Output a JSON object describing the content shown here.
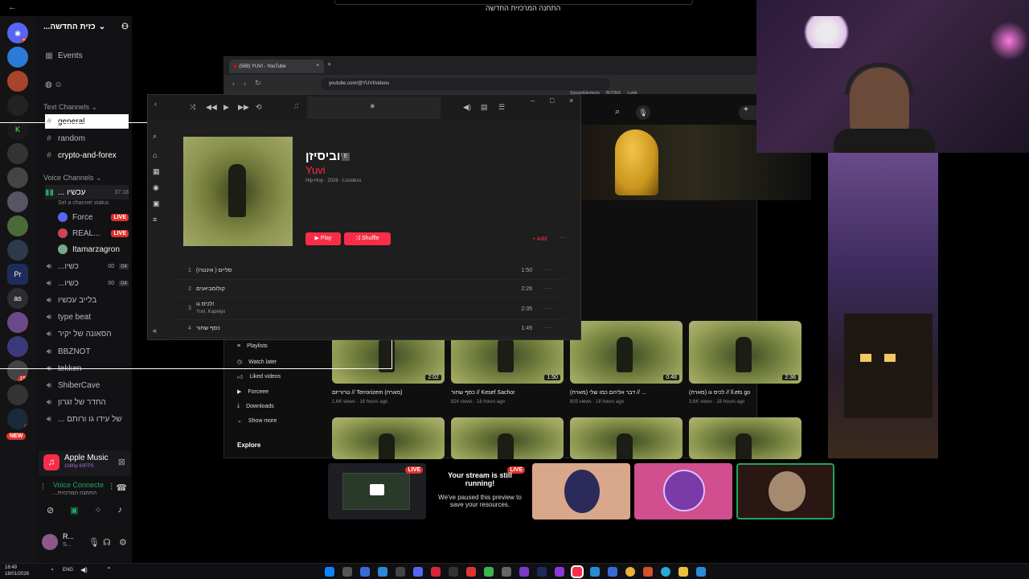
{
  "top_bar": {
    "server_title": "התחנה המרכזית החדשה"
  },
  "server_rail": {
    "badges": [
      "52",
      "6",
      "2",
      "9",
      "152",
      "8"
    ],
    "labels": [
      "Pr",
      "as"
    ],
    "new_label": "NEW"
  },
  "sidebar": {
    "server_name": "...כזית החדשה",
    "events": "Events",
    "text_channels_label": "Text Channels",
    "text_channels": [
      "general",
      "random",
      "crypto-and-forex"
    ],
    "voice_channels_label": "Voice Channels",
    "voice_active": {
      "name": "... עכשיו",
      "time": "37:18",
      "status": "Set a channel status"
    },
    "voice_users": [
      {
        "name": "Force",
        "live": "LIVE"
      },
      {
        "name": "REAL...",
        "live": "LIVE"
      },
      {
        "name": "Itamarzagron",
        "live": ""
      }
    ],
    "voice_channels": [
      {
        "name": "...כשיו",
        "a": "00",
        "b": "04"
      },
      {
        "name": "...כשיו",
        "a": "00",
        "b": "04"
      },
      {
        "name": "בלייב עכשיו",
        "a": "",
        "b": ""
      },
      {
        "name": "type beat",
        "a": "",
        "b": ""
      },
      {
        "name": "הסאונה של יקיר",
        "a": "",
        "b": ""
      },
      {
        "name": "BBZNOT",
        "a": "",
        "b": ""
      },
      {
        "name": "tekken",
        "a": "",
        "b": ""
      },
      {
        "name": "ShiberCave",
        "a": "",
        "b": ""
      },
      {
        "name": "החדר של זגרון",
        "a": "",
        "b": ""
      },
      {
        "name": "... של עידו גו ורותם",
        "a": "",
        "b": ""
      }
    ],
    "activity": {
      "title": "Apple Music",
      "sub": "1080p 60FPS"
    },
    "voice_connected": {
      "title": "Voice Connecte",
      "sub": "...התחנה המרכזית"
    },
    "user": {
      "name": "R...",
      "status": "S..."
    }
  },
  "youtube": {
    "tab_title": "(569) YUVI - YouTube",
    "url": "youtube.com/@YUVI/videos",
    "bookmarks": [
      "Sites",
      "YouTube Music",
      "Home",
      "Twitch",
      "Kick",
      "BOTBIX",
      "Lurkit",
      "StreamElements"
    ],
    "nav": [
      "Playlists",
      "Watch later",
      "Liked videos",
      "Forceee",
      "Downloads",
      "Show more"
    ],
    "explore": "Explore",
    "videos_row1": [
      {
        "title": "טרוריזם // Terrorizem (מארח)",
        "meta": "1.6K views · 18 hours ago",
        "dur": "2:02"
      },
      {
        "title": "כסף שחור // Kesef Sachor",
        "meta": "824 views · 18 hours ago",
        "dur": "1:50"
      },
      {
        "title": "(מארח) דבר אליהם כמו שלי // ...",
        "meta": "803 views · 18 hours ago",
        "dur": "0:48"
      },
      {
        "title": "(מארח) לכיס גו // ll.ets go",
        "meta": "3.6K views · 18 hours ago",
        "dur": "2:36"
      }
    ]
  },
  "apple_music": {
    "album": "יוביסיזן",
    "artist": "Yuvi",
    "meta": "Hip-Hop · 2026 · Lossless",
    "play": "Play",
    "shuffle": "Shuffle",
    "add": "+ Add",
    "tracks": [
      {
        "n": "1",
        "title": "סליים ( אינטרו)",
        "sub": "",
        "dur": "1:50"
      },
      {
        "n": "2",
        "title": "קולומביאנים",
        "sub": "",
        "dur": "2:26"
      },
      {
        "n": "3",
        "title": "לכיס גו!",
        "sub": "Yuvi, Kapelyo",
        "dur": "2:35"
      },
      {
        "n": "4",
        "title": "כסף שחור",
        "sub": "",
        "dur": "1:49"
      }
    ]
  },
  "stream": {
    "live": "LIVE",
    "paused_title": "Your stream is still running!",
    "paused_sub": "We've paused this preview to save your resources."
  },
  "taskbar": {
    "time": "18:49",
    "date": "18/01/2026",
    "lang": "ENG"
  },
  "colors": {
    "accent": "#fa2d48",
    "live": "#e0322d",
    "discord_bg": "#121214"
  }
}
